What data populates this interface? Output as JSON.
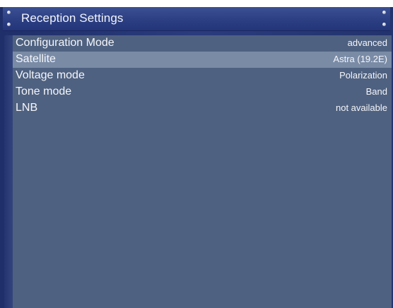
{
  "window": {
    "title": "Reception Settings"
  },
  "settings": [
    {
      "label": "Configuration Mode",
      "value": "advanced",
      "selected": false
    },
    {
      "label": "Satellite",
      "value": "Astra (19.2E)",
      "selected": true
    },
    {
      "label": "Voltage mode",
      "value": "Polarization",
      "selected": false
    },
    {
      "label": "Tone mode",
      "value": "Band",
      "selected": false
    },
    {
      "label": "LNB",
      "value": "not available",
      "selected": false
    }
  ],
  "colors": {
    "frame": "#2a3c7d",
    "content_bg": "#4f6180",
    "selected_row": "#7a8ba6",
    "text": "#f4f6fa"
  }
}
